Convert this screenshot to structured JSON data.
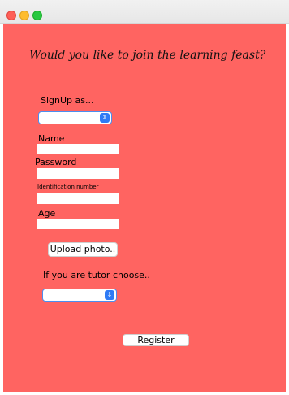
{
  "window": {
    "controls": [
      "close-icon",
      "minimize-icon",
      "maximize-icon"
    ],
    "colors": {
      "background": "#ff6461",
      "close": "#fe5f57",
      "minimize": "#febc2e",
      "maximize": "#28c840",
      "select_accent": "#2f7bf5"
    }
  },
  "form": {
    "headline": "Would you like to join the learning feast?",
    "signup_label": "SignUp as...",
    "signup_select_value": "",
    "name_label": "Name",
    "name_value": "",
    "password_label": "Password",
    "password_value": "",
    "id_label": "Identification number",
    "id_value": "",
    "age_label": "Age",
    "age_value": "",
    "upload_button": "Upload photo..",
    "tutor_label": "If you are tutor choose..",
    "tutor_select_value": "",
    "register_button": "Register",
    "select_arrow_glyph": "⇕"
  }
}
